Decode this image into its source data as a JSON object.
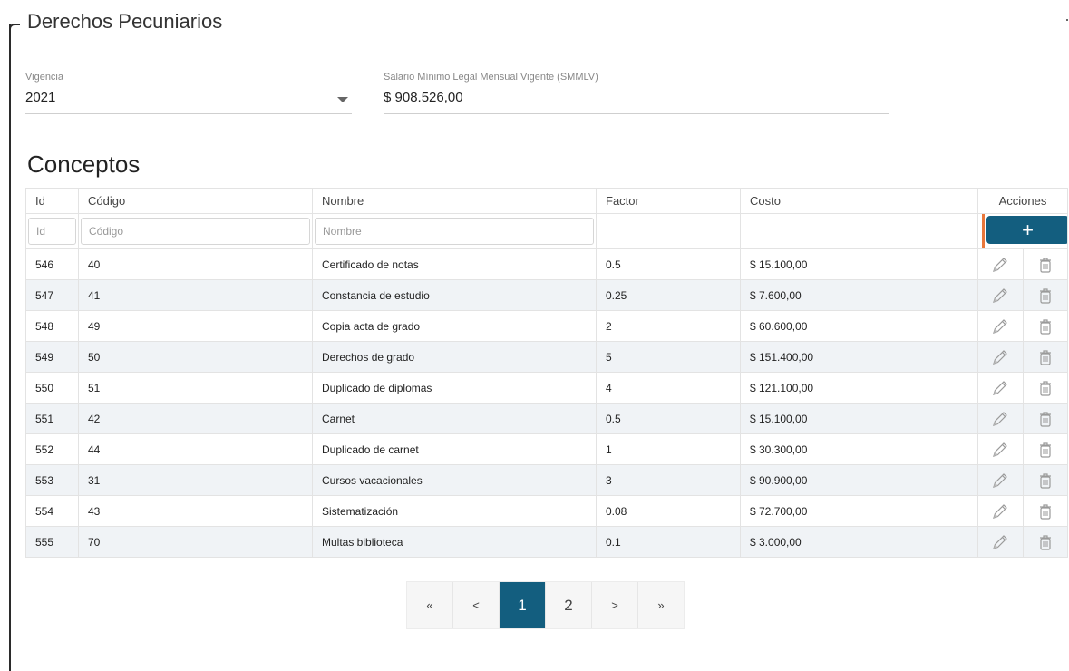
{
  "section": {
    "title": "Derechos Pecuniarios"
  },
  "vigencia": {
    "label": "Vigencia",
    "value": "2021"
  },
  "smmlv": {
    "label": "Salario Mínimo Legal Mensual Vigente (SMMLV)",
    "value": "$ 908.526,00"
  },
  "conceptos": {
    "title": "Conceptos",
    "columns": {
      "id": "Id",
      "codigo": "Código",
      "nombre": "Nombre",
      "factor": "Factor",
      "costo": "Costo",
      "acciones": "Acciones"
    },
    "filters": {
      "id_placeholder": "Id",
      "codigo_placeholder": "Código",
      "nombre_placeholder": "Nombre"
    },
    "add_label": "+",
    "rows": [
      {
        "id": "546",
        "codigo": "40",
        "nombre": "Certificado de notas",
        "factor": "0.5",
        "costo": "$ 15.100,00"
      },
      {
        "id": "547",
        "codigo": "41",
        "nombre": "Constancia de estudio",
        "factor": "0.25",
        "costo": "$ 7.600,00"
      },
      {
        "id": "548",
        "codigo": "49",
        "nombre": "Copia acta de grado",
        "factor": "2",
        "costo": "$ 60.600,00"
      },
      {
        "id": "549",
        "codigo": "50",
        "nombre": "Derechos de grado",
        "factor": "5",
        "costo": "$ 151.400,00"
      },
      {
        "id": "550",
        "codigo": "51",
        "nombre": "Duplicado de diplomas",
        "factor": "4",
        "costo": "$ 121.100,00"
      },
      {
        "id": "551",
        "codigo": "42",
        "nombre": "Carnet",
        "factor": "0.5",
        "costo": "$ 15.100,00"
      },
      {
        "id": "552",
        "codigo": "44",
        "nombre": "Duplicado de carnet",
        "factor": "1",
        "costo": "$ 30.300,00"
      },
      {
        "id": "553",
        "codigo": "31",
        "nombre": "Cursos vacacionales",
        "factor": "3",
        "costo": "$ 90.900,00"
      },
      {
        "id": "554",
        "codigo": "43",
        "nombre": "Sistematización",
        "factor": "0.08",
        "costo": "$ 72.700,00"
      },
      {
        "id": "555",
        "codigo": "70",
        "nombre": "Multas biblioteca",
        "factor": "0.1",
        "costo": "$ 3.000,00"
      }
    ]
  },
  "pagination": {
    "first": "«",
    "prev": "<",
    "pages": [
      "1",
      "2"
    ],
    "current": "1",
    "next": ">",
    "last": "»"
  },
  "colors": {
    "primary": "#135e7f",
    "highlight": "#e9773b",
    "row_alt": "#f0f3f6"
  },
  "icons": {
    "edit": "pencil-icon",
    "delete": "trash-icon",
    "dropdown": "caret-down-icon"
  }
}
